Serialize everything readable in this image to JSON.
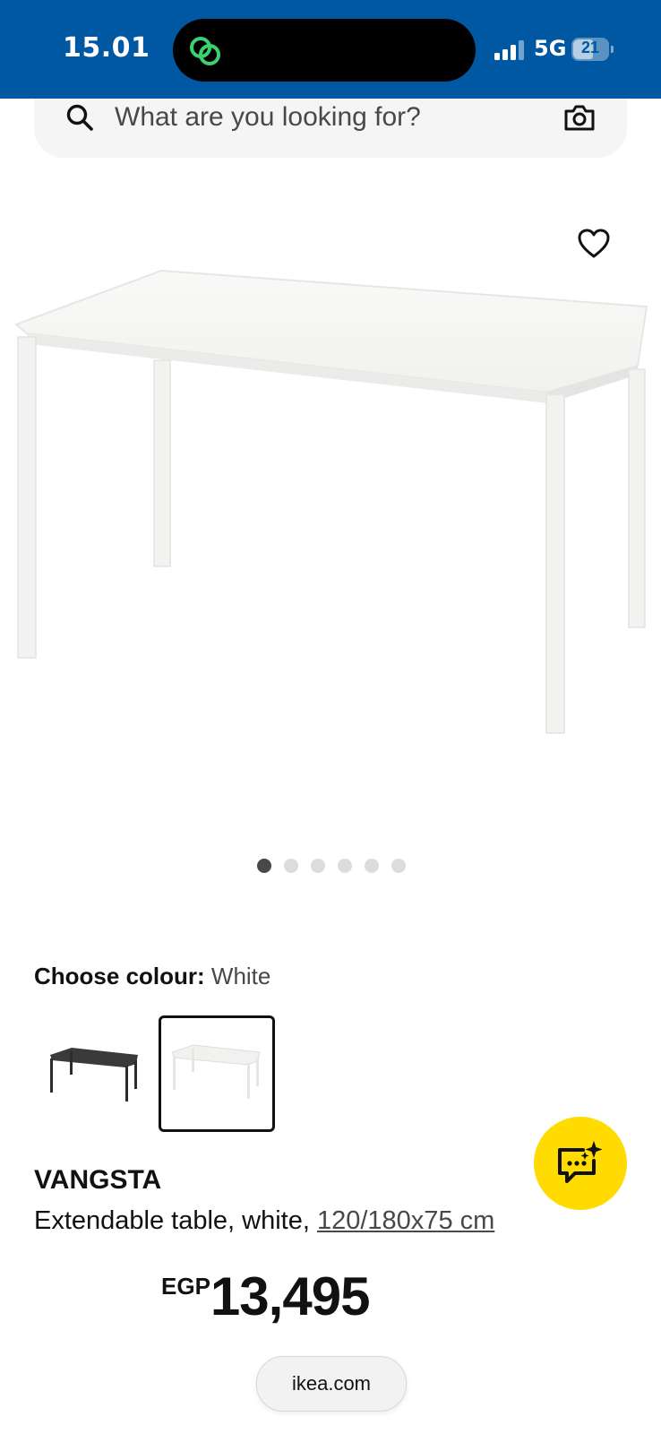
{
  "status_bar": {
    "time": "15.01",
    "network": "5G",
    "battery": "21",
    "background_color": "#0058a3",
    "island_icon": "link-icon"
  },
  "search": {
    "placeholder": "What are you looking for?",
    "search_icon": "search-icon",
    "camera_icon": "camera-icon"
  },
  "product_image": {
    "favourite_icon": "heart-icon",
    "carousel_total": 6,
    "carousel_active_index": 0
  },
  "colour": {
    "label": "Choose colour:",
    "value": "White",
    "swatches": [
      "black",
      "white"
    ],
    "selected": "white"
  },
  "assistant": {
    "icon": "chat-sparkle-icon",
    "color": "#ffdb00"
  },
  "product": {
    "name": "VANGSTA",
    "description_prefix": "Extendable table, white, ",
    "measurements": "120/180x75 cm",
    "currency": "EGP",
    "price": "13,495"
  },
  "browser": {
    "domain": "ikea.com"
  }
}
